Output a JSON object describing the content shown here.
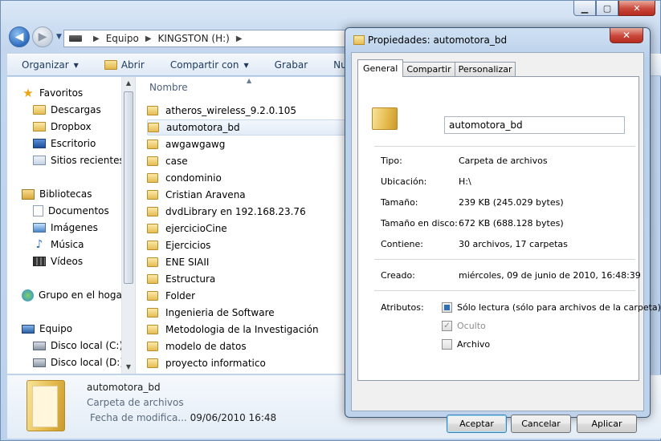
{
  "explorer": {
    "address": {
      "segments": [
        "Equipo",
        "KINGSTON (H:)"
      ]
    },
    "toolbar": [
      "Organizar",
      "Abrir",
      "Compartir con",
      "Grabar",
      "Nueva ca"
    ],
    "nav_pane": {
      "items": [
        {
          "label": "Favoritos",
          "icon": "star-icon"
        },
        {
          "label": "Descargas",
          "icon": "downloads-folder-icon"
        },
        {
          "label": "Dropbox",
          "icon": "dropbox-folder-icon"
        },
        {
          "label": "Escritorio",
          "icon": "desktop-icon"
        },
        {
          "label": "Sitios recientes",
          "icon": "recent-places-icon"
        },
        {
          "label": "Bibliotecas",
          "icon": "libraries-icon"
        },
        {
          "label": "Documentos",
          "icon": "documents-icon"
        },
        {
          "label": "Imágenes",
          "icon": "pictures-icon"
        },
        {
          "label": "Música",
          "icon": "music-icon"
        },
        {
          "label": "Vídeos",
          "icon": "videos-icon"
        },
        {
          "label": "Grupo en el hogar",
          "icon": "homegroup-icon"
        },
        {
          "label": "Equipo",
          "icon": "computer-icon"
        },
        {
          "label": "Disco local (C:)",
          "icon": "local-disk-icon"
        },
        {
          "label": "Disco local (D:)",
          "icon": "local-disk-icon"
        }
      ]
    },
    "file_list": {
      "column_header": "Nombre",
      "files": [
        "atheros_wireless_9.2.0.105",
        "automotora_bd",
        "awgawgawg",
        "case",
        "condominio",
        "Cristian Aravena",
        "dvdLibrary en 192.168.23.76",
        "ejercicioCine",
        "Ejercicios",
        "ENE SIAII",
        "Estructura",
        "Folder",
        "Ingenieria de Software",
        "Metodologia de la Investigación",
        "modelo de datos",
        "proyecto informatico"
      ]
    },
    "details_pane": {
      "name": "automotora_bd",
      "type": "Carpeta de archivos",
      "date_label": "Fecha de modifica...",
      "date_value": "09/06/2010 16:48"
    }
  },
  "dialog": {
    "title": "Propiedades: automotora_bd",
    "close_label": "✕",
    "tabs": [
      "General",
      "Compartir",
      "Personalizar"
    ],
    "name_value": "automotora_bd",
    "properties": [
      {
        "label": "Tipo:",
        "value": "Carpeta de archivos"
      },
      {
        "label": "Ubicación:",
        "value": "H:\\"
      },
      {
        "label": "Tamaño:",
        "value": "239 KB (245.029 bytes)"
      },
      {
        "label": "Tamaño en disco:",
        "value": "672 KB (688.128 bytes)"
      },
      {
        "label": "Contiene:",
        "value": "30 archivos, 17 carpetas"
      },
      {
        "label": "Creado:",
        "value": "miércoles, 09 de junio de 2010, 16:48:39"
      }
    ],
    "attributes_label": "Atributos:",
    "attributes": [
      {
        "label": "Sólo lectura (sólo para archivos de la carpeta)",
        "state": "indeterminate"
      },
      {
        "label": "Oculto",
        "state": "checked-disabled"
      },
      {
        "label": "Archivo",
        "state": "unchecked"
      }
    ],
    "buttons": {
      "ok": "Aceptar",
      "cancel": "Cancelar",
      "apply": "Aplicar"
    }
  }
}
